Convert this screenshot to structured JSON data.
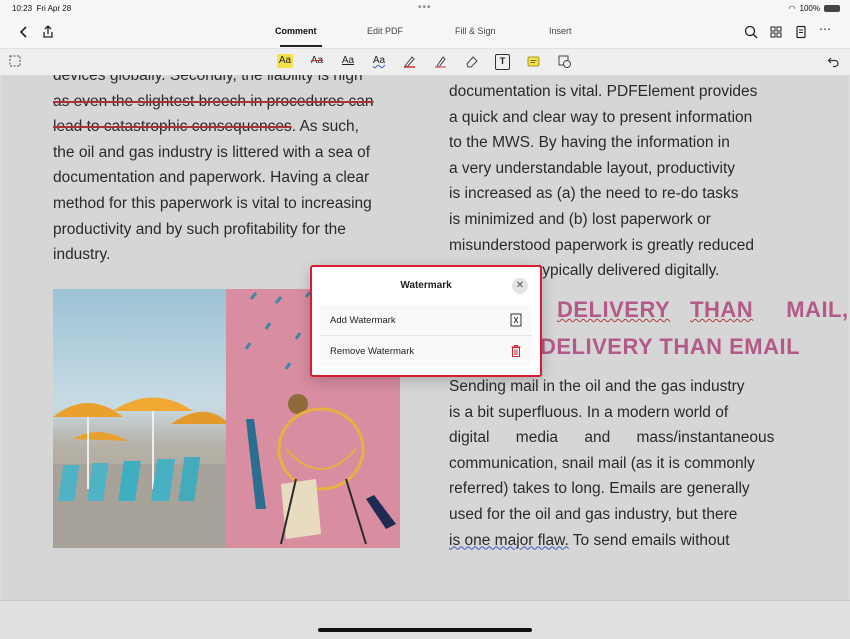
{
  "status": {
    "time": "10:23",
    "date": "Fri Apr 28",
    "battery": "100%"
  },
  "nav": {
    "tabs": [
      "Comment",
      "Edit PDF",
      "Fill & Sign",
      "Insert"
    ],
    "active_tab": "Comment"
  },
  "toolbar": {
    "aa": "Aa",
    "text_tool": "T"
  },
  "document": {
    "left_lines": [
      "devices globally. Secondly, the liability is high",
      "as even the slightest breech in procedures can",
      "lead to catastrophic consequences",
      ". As such,",
      "the oil and gas industry is littered with a sea of",
      "documentation and paperwork. Having a clear",
      "method for this paperwork is vital to increasing",
      "productivity and by such profitability for the",
      "industry."
    ],
    "right_lines_top": [
      "documentation is vital. PDFElement provides",
      "a quick and clear way to present information",
      "to the MWS. By having the information in",
      "a very understandable layout, productivity",
      "is increased as (a) the need to re-do tasks",
      "is minimized and (b) lost paperwork or",
      "misunderstood paperwork is greatly reduced",
      "typically delivered digitally."
    ],
    "heading_line1": [
      "DELIVERY",
      "THAN",
      "MAIL,"
    ],
    "heading_line2": "DELIVERY THAN EMAIL",
    "right_lines_bottom": [
      "Sending mail in the oil and the gas industry",
      "is a bit superfluous. In a modern world of",
      "digital media and mass/instantaneous",
      "communication, snail mail (as it is commonly",
      "referred) takes to long. Emails are generally",
      "used for the oil and gas industry, but there"
    ],
    "last_line_underlined": "is one major flaw.",
    "last_line_rest": " To send emails without"
  },
  "popover": {
    "title": "Watermark",
    "items": [
      {
        "label": "Add Watermark",
        "icon": "watermark-doc-icon"
      },
      {
        "label": "Remove Watermark",
        "icon": "trash-icon"
      }
    ]
  },
  "colors": {
    "accent_red": "#d81e2e",
    "heading_pink": "#b45a88",
    "highlight_yellow": "#f2e14a"
  }
}
